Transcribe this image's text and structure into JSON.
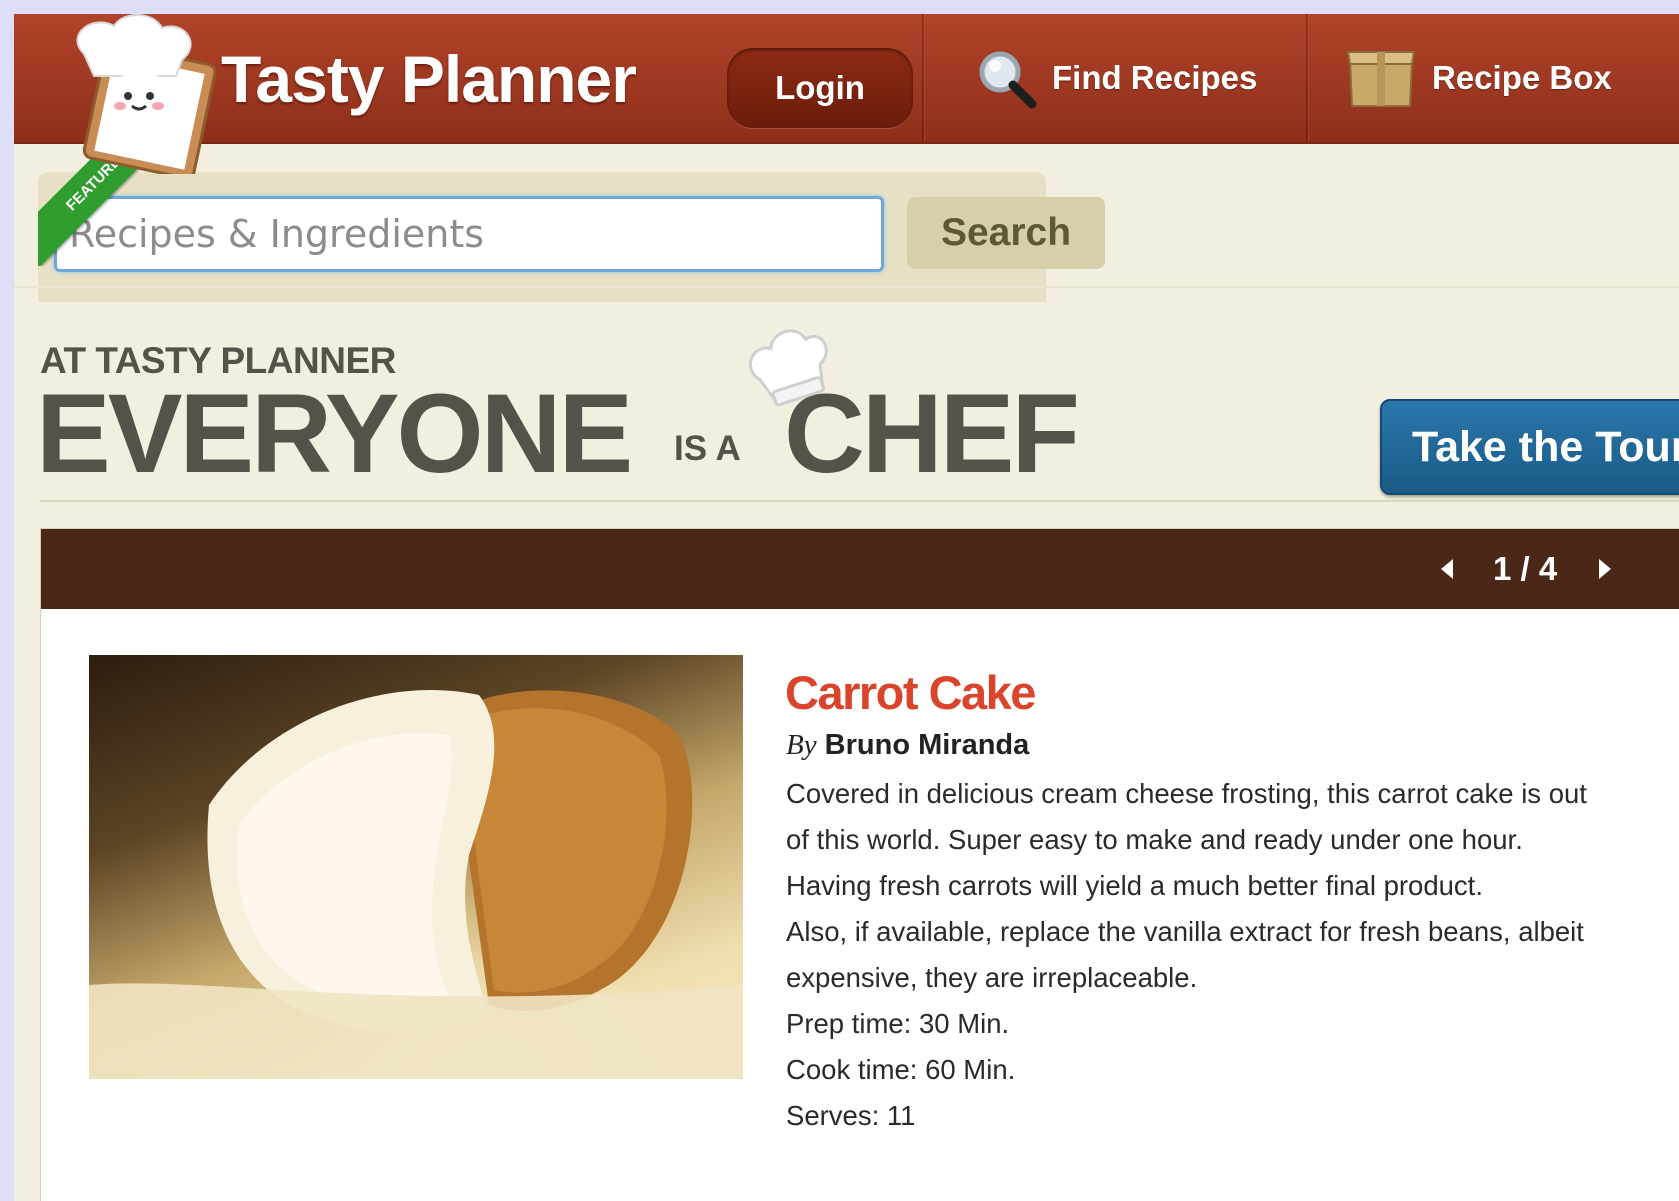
{
  "header": {
    "site_name": "Tasty Planner",
    "login_label": "Login",
    "nav": [
      {
        "label": "Find Recipes",
        "icon": "magnifier-icon"
      },
      {
        "label": "Recipe Box",
        "icon": "box-icon"
      }
    ]
  },
  "search": {
    "value": "Recipes & Ingredients",
    "button_label": "Search"
  },
  "tagline": {
    "small": "AT TASTY PLANNER",
    "word1": "EVERYONE",
    "connector": "IS A",
    "word2": "CHEF",
    "tour_label": "Take the Tour"
  },
  "feature": {
    "pager": "1 / 4",
    "ribbon": "FEATURE",
    "title": "Carrot Cake",
    "by": "By",
    "author": "Bruno Miranda",
    "description": [
      "Covered in delicious cream cheese frosting, this carrot cake is out of this world. Super easy to make and ready under one hour. Having fresh carrots will yield a much better final product.",
      "Also, if available, replace the vanilla extract for fresh beans, albeit expensive, they are irreplaceable.",
      "Prep time: 30 Min.",
      "Cook time: 60 Min.",
      "Serves: 11"
    ]
  },
  "colors": {
    "header": "#a33a22",
    "title": "#d9452a",
    "tour_button": "#1f6b9a",
    "feature_bar": "#4a2716",
    "ribbon": "#2f9e2e"
  }
}
